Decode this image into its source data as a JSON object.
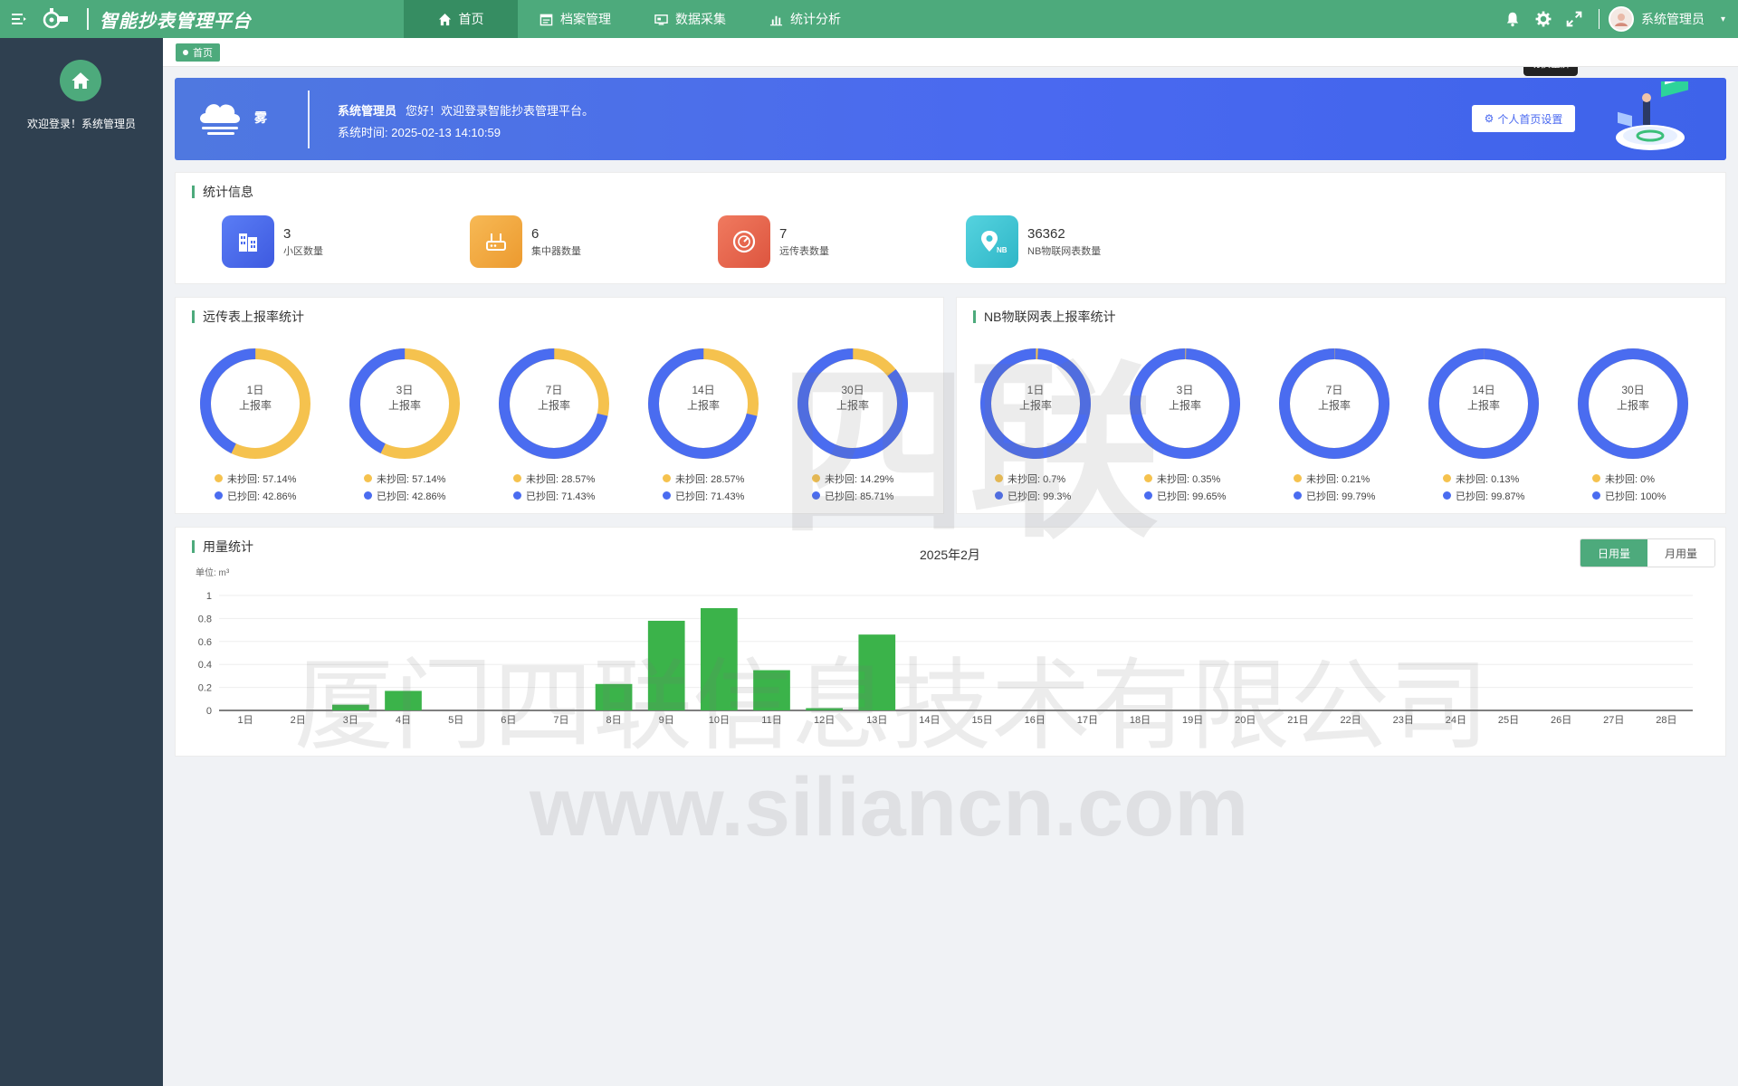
{
  "app": {
    "title": "智能抄表管理平台",
    "nav": [
      {
        "label": "首页",
        "icon": "home-icon",
        "active": true
      },
      {
        "label": "档案管理",
        "icon": "calendar-icon",
        "active": false
      },
      {
        "label": "数据采集",
        "icon": "monitor-icon",
        "active": false
      },
      {
        "label": "统计分析",
        "icon": "bar-chart-icon",
        "active": false
      }
    ],
    "user": "系统管理员",
    "fullscreen_tooltip": "切换全屏"
  },
  "sidebar": {
    "welcome": "欢迎登录！系统管理员"
  },
  "tags": {
    "home": "首页"
  },
  "banner": {
    "weather": "雾",
    "user": "系统管理员",
    "greeting": "您好！欢迎登录智能抄表管理平台。",
    "time_label": "系统时间:",
    "time": "2025-02-13 14:10:59",
    "settings_button": "个人首页设置"
  },
  "stats": {
    "title": "统计信息",
    "items": [
      {
        "value": "3",
        "label": "小区数量",
        "color": "#4a6cf0"
      },
      {
        "value": "6",
        "label": "集中器数量",
        "color": "#f0a940"
      },
      {
        "value": "7",
        "label": "远传表数量",
        "color": "#e9664f"
      },
      {
        "value": "36362",
        "label": "NB物联网表数量",
        "color": "#3fc5d4"
      }
    ]
  },
  "colors": {
    "read": "#4a6cf0",
    "unread": "#f5c24e",
    "accent": "#4daa7c",
    "bar": "#3bb34a"
  },
  "remote_rate": {
    "title": "远传表上报率统计",
    "items": [
      {
        "day": "1日",
        "sub": "上报率",
        "unread_label": "未抄回: 57.14%",
        "read_label": "已抄回: 42.86%",
        "read": 42.86
      },
      {
        "day": "3日",
        "sub": "上报率",
        "unread_label": "未抄回: 57.14%",
        "read_label": "已抄回: 42.86%",
        "read": 42.86
      },
      {
        "day": "7日",
        "sub": "上报率",
        "unread_label": "未抄回: 28.57%",
        "read_label": "已抄回: 71.43%",
        "read": 71.43
      },
      {
        "day": "14日",
        "sub": "上报率",
        "unread_label": "未抄回: 28.57%",
        "read_label": "已抄回: 71.43%",
        "read": 71.43
      },
      {
        "day": "30日",
        "sub": "上报率",
        "unread_label": "未抄回: 14.29%",
        "read_label": "已抄回: 85.71%",
        "read": 85.71
      }
    ]
  },
  "nb_rate": {
    "title": "NB物联网表上报率统计",
    "items": [
      {
        "day": "1日",
        "sub": "上报率",
        "unread_label": "未抄回: 0.7%",
        "read_label": "已抄回: 99.3%",
        "read": 99.3
      },
      {
        "day": "3日",
        "sub": "上报率",
        "unread_label": "未抄回: 0.35%",
        "read_label": "已抄回: 99.65%",
        "read": 99.65
      },
      {
        "day": "7日",
        "sub": "上报率",
        "unread_label": "未抄回: 0.21%",
        "read_label": "已抄回: 99.79%",
        "read": 99.79
      },
      {
        "day": "14日",
        "sub": "上报率",
        "unread_label": "未抄回: 0.13%",
        "read_label": "已抄回: 99.87%",
        "read": 99.87
      },
      {
        "day": "30日",
        "sub": "上报率",
        "unread_label": "未抄回: 0%",
        "read_label": "已抄回: 100%",
        "read": 100
      }
    ]
  },
  "usage": {
    "title": "用量统计",
    "month": "2025年2月",
    "daily_label": "日用量",
    "monthly_label": "月用量"
  },
  "chart_data": {
    "type": "bar",
    "unit_label": "单位: m³",
    "categories": [
      "1日",
      "2日",
      "3日",
      "4日",
      "5日",
      "6日",
      "7日",
      "8日",
      "9日",
      "10日",
      "11日",
      "12日",
      "13日",
      "14日",
      "15日",
      "16日",
      "17日",
      "18日",
      "19日",
      "20日",
      "21日",
      "22日",
      "23日",
      "24日",
      "25日",
      "26日",
      "27日",
      "28日"
    ],
    "values": [
      0,
      0,
      0.05,
      0.17,
      0,
      0,
      0,
      0.23,
      0.78,
      0.89,
      0.35,
      0.02,
      0.66,
      0,
      0,
      0,
      0,
      0,
      0,
      0,
      0,
      0,
      0,
      0,
      0,
      0,
      0,
      0
    ],
    "yticks": [
      "0",
      "0.2",
      "0.4",
      "0.6",
      "0.8",
      "1"
    ],
    "ylim": [
      0,
      1
    ],
    "grid": true
  },
  "watermark": {
    "brand": "四联",
    "company": "厦门四联信息技术有限公司",
    "url": "www.siliancn.com"
  }
}
